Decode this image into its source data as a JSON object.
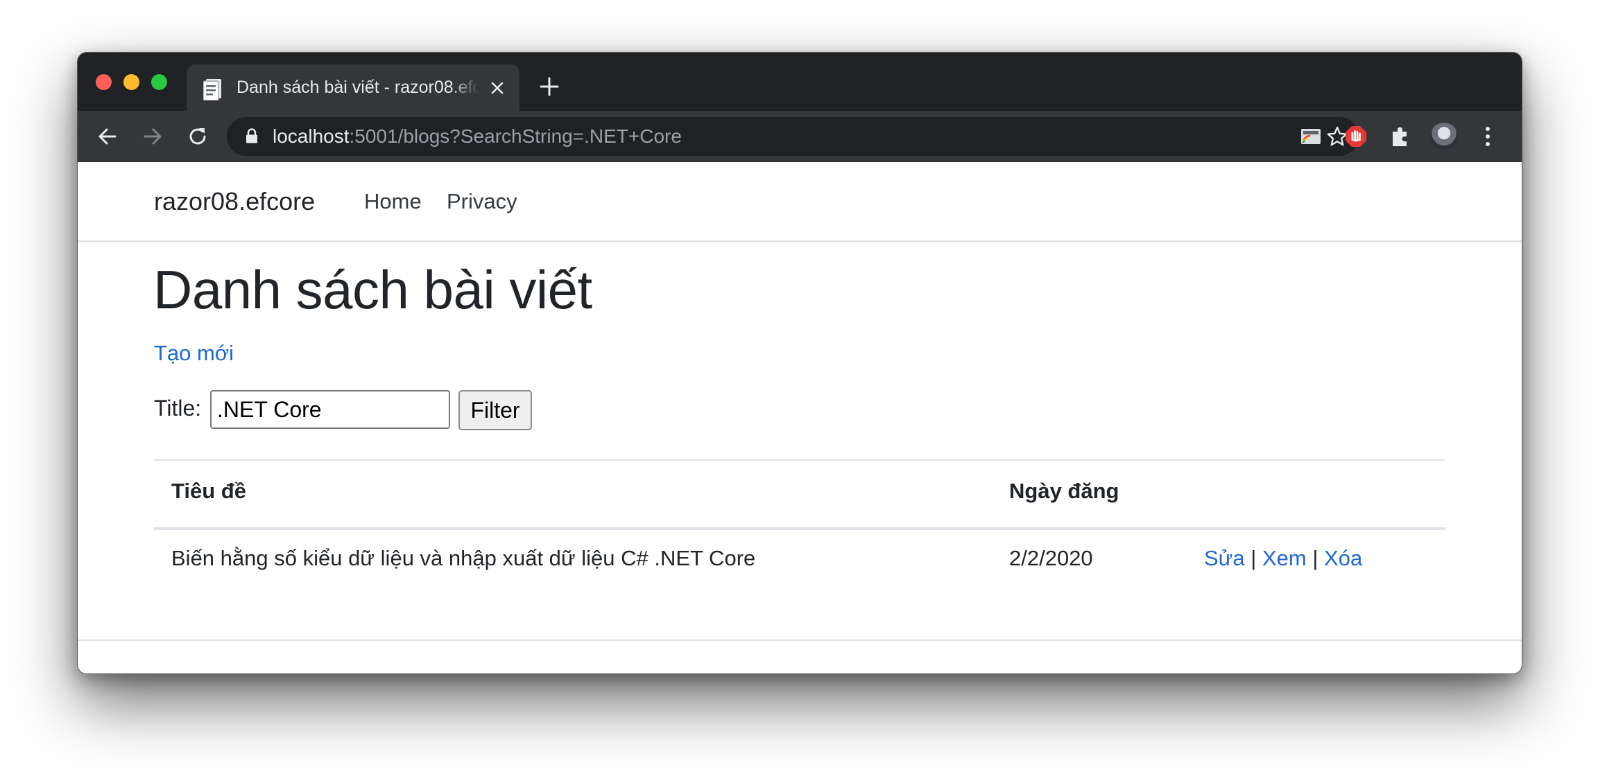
{
  "browser": {
    "tab_title": "Danh sách bài viết - razor08.efcore",
    "url_host": "localhost",
    "url_rest": ":5001/blogs?SearchString=.NET+Core",
    "icons": [
      "back-icon",
      "forward-icon",
      "reload-icon",
      "lock-icon",
      "star-icon",
      "cast-icon",
      "adblock-icon",
      "extensions-icon",
      "avatar",
      "menu-icon"
    ]
  },
  "navbar": {
    "brand": "razor08.efcore",
    "links": [
      "Home",
      "Privacy"
    ]
  },
  "main": {
    "title": "Danh sách bài viết",
    "create_link": "Tạo mới",
    "filter": {
      "label": "Title:",
      "value": ".NET Core",
      "button": "Filter"
    },
    "table": {
      "headers": [
        "Tiêu đề",
        "Ngày đăng"
      ],
      "rows": [
        {
          "title": "Biến hằng số kiểu dữ liệu và nhập xuất dữ liệu C# .NET Core",
          "date": "2/2/2020",
          "actions": [
            "Sửa",
            "Xem",
            "Xóa"
          ],
          "separator": "|"
        }
      ]
    }
  },
  "colors": {
    "link": "#1d68d2",
    "chrome_dark": "#202124",
    "chrome_toolbar": "#35363a"
  }
}
